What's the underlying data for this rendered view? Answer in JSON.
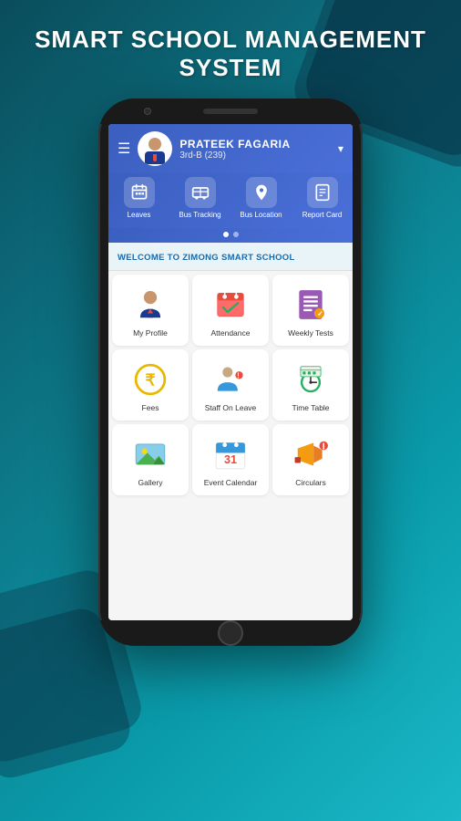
{
  "app": {
    "title_line1": "SMART SCHOOL MANAGEMENT",
    "title_line2": "SYSTEM"
  },
  "header": {
    "user_name": "PRATEEK FAGARIA",
    "user_class": "3rd-B (239)",
    "hamburger_label": "☰"
  },
  "quick_actions": [
    {
      "id": "leaves",
      "label": "Leaves",
      "icon": "📋"
    },
    {
      "id": "bus_tracking",
      "label": "Bus Tracking",
      "icon": "🚌"
    },
    {
      "id": "bus_location",
      "label": "Bus Location",
      "icon": "📍"
    },
    {
      "id": "report_card",
      "label": "Report Card",
      "icon": "📄"
    }
  ],
  "dots": {
    "active_index": 0,
    "count": 2
  },
  "welcome_banner": {
    "text": "WELCOME TO ZIMONG SMART SCHOOL"
  },
  "grid_items": [
    {
      "id": "my_profile",
      "label": "My Profile",
      "icon": "👨‍💼",
      "type": "emoji"
    },
    {
      "id": "attendance",
      "label": "Attendance",
      "icon": "📅",
      "type": "emoji"
    },
    {
      "id": "weekly_tests",
      "label": "Weekly Tests",
      "icon": "📋",
      "type": "emoji"
    },
    {
      "id": "fees",
      "label": "Fees",
      "icon": "₹",
      "type": "rupee"
    },
    {
      "id": "staff_on_leave",
      "label": "Staff On Leave",
      "icon": "👩‍💼",
      "type": "emoji"
    },
    {
      "id": "time_table",
      "label": "Time Table",
      "icon": "📆",
      "type": "emoji"
    },
    {
      "id": "gallery",
      "label": "Gallery",
      "icon": "🖼️",
      "type": "emoji"
    },
    {
      "id": "event_calendar",
      "label": "Event Calendar",
      "icon": "📅",
      "type": "calendar"
    },
    {
      "id": "circulars",
      "label": "Circulars",
      "icon": "📢",
      "type": "emoji"
    }
  ],
  "colors": {
    "header_gradient_start": "#3b5fc0",
    "header_gradient_end": "#4a6fd8",
    "background_start": "#0a4d5c",
    "background_end": "#1ab8c8",
    "welcome_text": "#1a6baa",
    "rupee_color": "#e8b800"
  }
}
